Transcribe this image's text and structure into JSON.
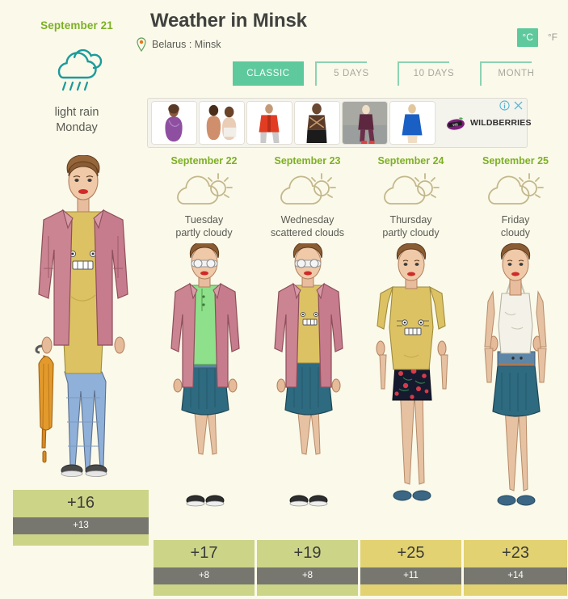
{
  "header": {
    "title": "Weather in Minsk",
    "location": "Belarus : Minsk",
    "location_icon": "map-pin-icon",
    "units": {
      "celsius": "°C",
      "fahrenheit": "°F",
      "active": "celsius"
    }
  },
  "tabs": [
    {
      "label": "CLASSIC",
      "active": true
    },
    {
      "label": "5 DAYS",
      "active": false
    },
    {
      "label": "10 DAYS",
      "active": false
    },
    {
      "label": "MONTH",
      "active": false
    }
  ],
  "today": {
    "date": "September 21",
    "condition": "light rain",
    "weekday": "Monday",
    "icon": "rain-cloud-icon",
    "high": "+16",
    "low": "+13",
    "high_color": "#ccd488",
    "low_color": "#77776f"
  },
  "ad": {
    "brand": "WILDBERRIES",
    "info_icon": "info-icon",
    "close_icon": "close-icon",
    "thumbnails": [
      "purple-lingerie-thumb",
      "two-models-thumb",
      "red-jacket-thumb",
      "patterned-top-thumb",
      "street-outfit-thumb",
      "blue-dress-thumb"
    ]
  },
  "forecast": [
    {
      "date": "September 22",
      "weekday": "Tuesday",
      "condition": "partly cloudy",
      "icon": "sun-behind-cloud-icon",
      "high": "+17",
      "low": "+8",
      "high_color": "#ccd488",
      "low_color": "#77776f",
      "outfit": "pink-jacket-green-top-teal-skirt"
    },
    {
      "date": "September 23",
      "weekday": "Wednesday",
      "condition": "scattered clouds",
      "icon": "sun-behind-cloud-icon",
      "high": "+19",
      "low": "+8",
      "high_color": "#ccd488",
      "low_color": "#77776f",
      "outfit": "pink-jacket-yellow-tee-teal-skirt"
    },
    {
      "date": "September 24",
      "weekday": "Thursday",
      "condition": "partly cloudy",
      "icon": "sun-behind-cloud-icon",
      "high": "+25",
      "low": "+11",
      "high_color": "#e2d272",
      "low_color": "#77776f",
      "outfit": "yellow-tee-floral-skirt"
    },
    {
      "date": "September 25",
      "weekday": "Friday",
      "condition": "cloudy",
      "icon": "sun-behind-cloud-icon",
      "high": "+23",
      "low": "+14",
      "high_color": "#e2d272",
      "low_color": "#77776f",
      "outfit": "white-camisole-teal-skirt"
    }
  ],
  "colors": {
    "background": "#fbf9e9",
    "accent_green": "#7cb025",
    "teal": "#5ec99c",
    "text_dark": "#41423f",
    "text_gray": "#5b5b55",
    "today_icon": "#1b9b9b",
    "forecast_icon": "#c3b78c"
  }
}
